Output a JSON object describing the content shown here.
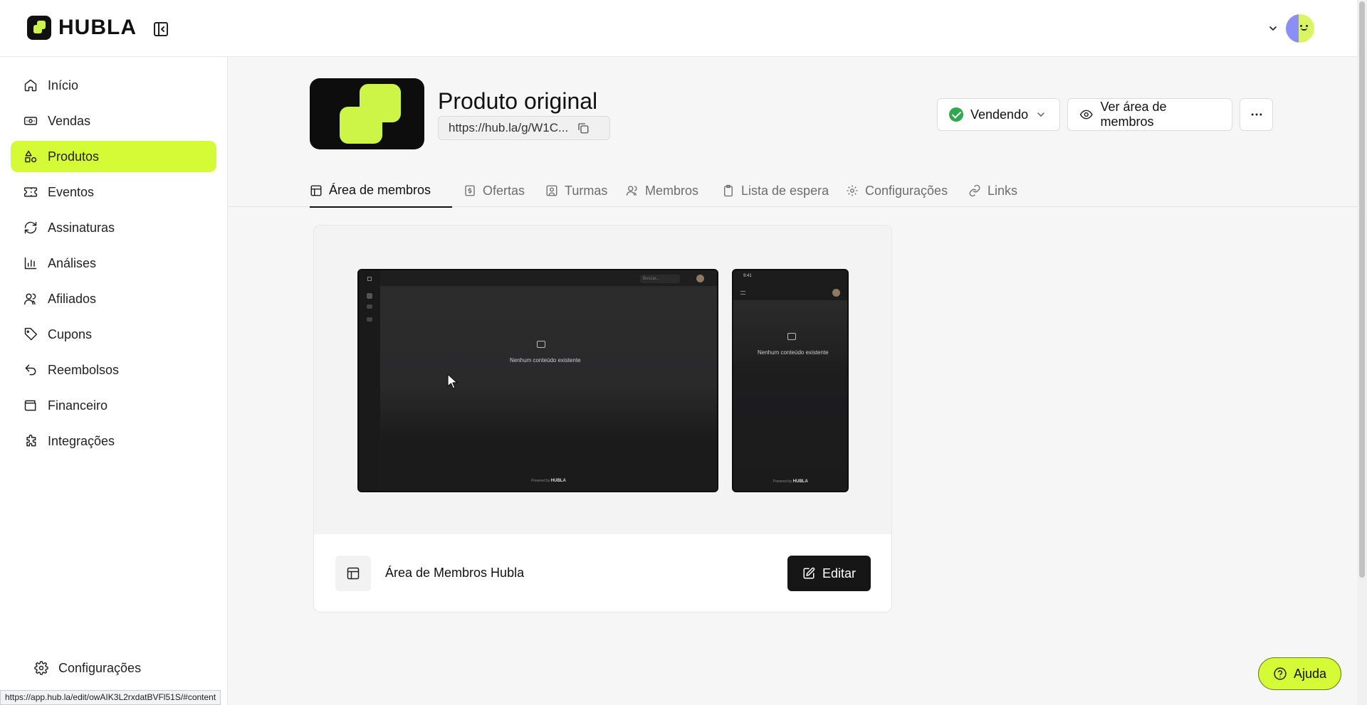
{
  "app": {
    "logo_text": "HUBLA",
    "brand_color": "#d4fb36"
  },
  "sidebar": {
    "items": [
      {
        "label": "Início",
        "icon": "home-icon",
        "active": false
      },
      {
        "label": "Vendas",
        "icon": "banknote-icon",
        "active": false
      },
      {
        "label": "Produtos",
        "icon": "shapes-icon",
        "active": true
      },
      {
        "label": "Eventos",
        "icon": "ticket-icon",
        "active": false
      },
      {
        "label": "Assinaturas",
        "icon": "refresh-icon",
        "active": false
      },
      {
        "label": "Análises",
        "icon": "bar-chart-icon",
        "active": false
      },
      {
        "label": "Afiliados",
        "icon": "users-icon",
        "active": false
      },
      {
        "label": "Cupons",
        "icon": "tag-icon",
        "active": false
      },
      {
        "label": "Reembolsos",
        "icon": "undo-icon",
        "active": false
      },
      {
        "label": "Financeiro",
        "icon": "wallet-icon",
        "active": false
      },
      {
        "label": "Integrações",
        "icon": "puzzle-icon",
        "active": false
      }
    ],
    "settings_label": "Configurações"
  },
  "product": {
    "title": "Produto original",
    "url": "https://hub.la/g/W1C...",
    "status_label": "Vendendo",
    "members_button": "Ver área de membros"
  },
  "tabs": [
    {
      "label": "Área de membros",
      "icon": "layout-icon",
      "active": true
    },
    {
      "label": "Ofertas",
      "icon": "dollar-icon",
      "active": false
    },
    {
      "label": "Turmas",
      "icon": "contact-icon",
      "active": false
    },
    {
      "label": "Membros",
      "icon": "users-icon",
      "active": false
    },
    {
      "label": "Lista de espera",
      "icon": "clipboard-icon",
      "active": false
    },
    {
      "label": "Configurações",
      "icon": "gear-icon",
      "active": false
    },
    {
      "label": "Links",
      "icon": "link-icon",
      "active": false
    }
  ],
  "members_area": {
    "preview": {
      "search_placeholder": "Buscar...",
      "empty_text": "Nenhum conteúdo existente",
      "powered_by": "Powered by",
      "powered_brand": "HUBLA",
      "phone_time": "9:41"
    },
    "name": "Área de Membros Hubla",
    "edit_label": "Editar"
  },
  "help": {
    "label": "Ajuda"
  },
  "status_bar": {
    "url": "https://app.hub.la/edit/owAIK3L2rxdatBVFl51S/#content"
  }
}
